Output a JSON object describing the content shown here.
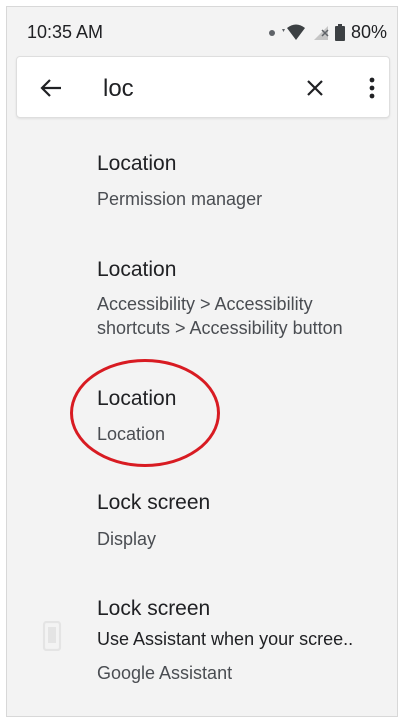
{
  "status_bar": {
    "time": "10:35 AM",
    "battery": "80%"
  },
  "search": {
    "query": "loc",
    "back_icon": "arrow-back-icon",
    "clear_icon": "close-icon",
    "more_icon": "more-vert-icon"
  },
  "results": [
    {
      "title": "Location",
      "subtitle": "Permission manager"
    },
    {
      "title": "Location",
      "subtitle_line1": "Accessibility > Accessibility",
      "subtitle_line2": "shortcuts > Accessibility button"
    },
    {
      "title": "Location",
      "subtitle": "Location"
    },
    {
      "title": "Lock screen",
      "subtitle": "Display"
    },
    {
      "title": "Lock screen",
      "line2": "Use Assistant when your scree..",
      "subtitle": "Google Assistant",
      "icon": "phone-icon"
    }
  ],
  "annotation": {
    "color": "#d81b22"
  }
}
